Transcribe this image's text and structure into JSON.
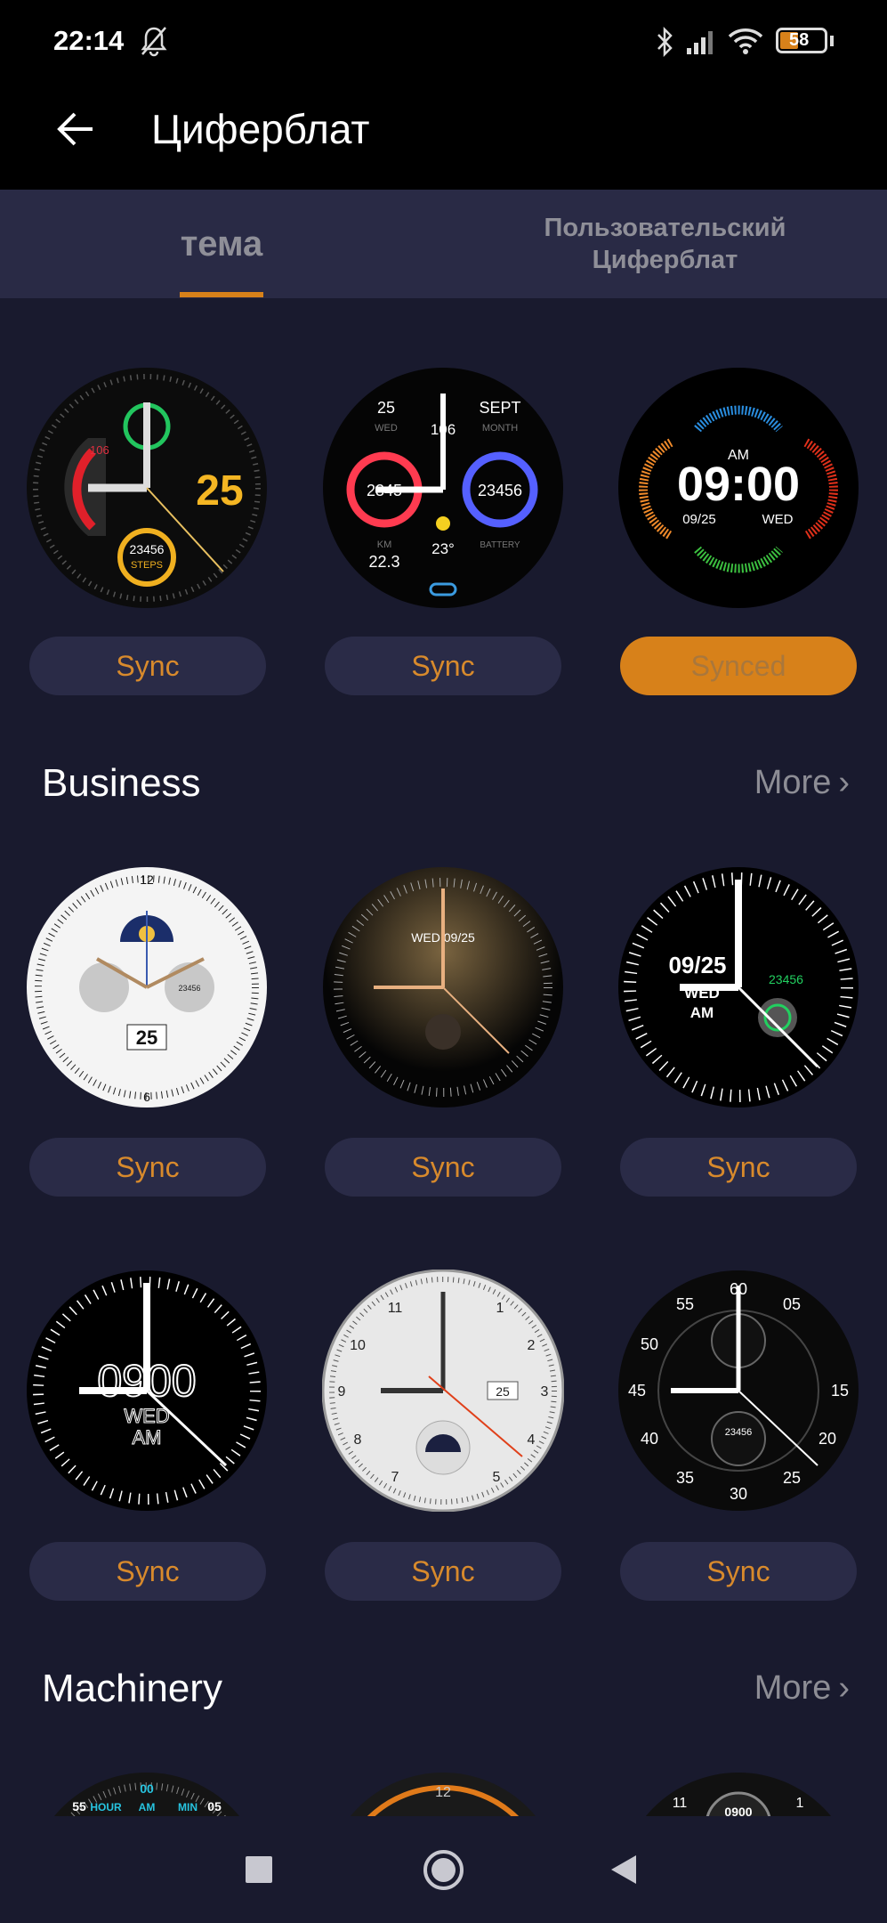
{
  "status": {
    "time": "22:14",
    "battery": "58",
    "icons": [
      "bell-off-icon",
      "bluetooth-icon",
      "signal-icon",
      "wifi-icon",
      "battery-icon"
    ]
  },
  "header": {
    "title": "Циферблат",
    "back_icon": "arrow-left-icon"
  },
  "tabs": [
    {
      "label": "тема",
      "active": true
    },
    {
      "label": "Пользовательский Циферблат",
      "active": false
    }
  ],
  "colors": {
    "background": "#191a2e",
    "tabbar": "#292a45",
    "button": "#2a2b47",
    "accent": "#d7811a",
    "button_text": "#d88a2c"
  },
  "recent": {
    "faces": [
      {
        "texts": {
          "date": "25",
          "hr": "106",
          "steps": "23456",
          "steps_label": "STEPS"
        },
        "button": "Sync"
      },
      {
        "texts": {
          "day": "25",
          "dow": "WED",
          "month": "SEPT",
          "month_label": "MONTH",
          "hr": "106",
          "cal": "2345",
          "steps": "23456",
          "temp": "23°",
          "km_label": "KM",
          "km": "22.3",
          "battery_label": "BATTERY"
        },
        "button": "Sync"
      },
      {
        "texts": {
          "ampm": "AM",
          "time": "09:00",
          "date": "09/25",
          "dow": "WED"
        },
        "button": "Synced"
      }
    ]
  },
  "business": {
    "title": "Business",
    "more": "More",
    "faces": [
      {
        "texts": {
          "date": "25",
          "num12": "12",
          "num6": "6",
          "steps": "23456"
        },
        "button": "Sync"
      },
      {
        "texts": {
          "date": "WED 09/25"
        },
        "button": "Sync"
      },
      {
        "texts": {
          "date": "09/25",
          "dow": "WED",
          "ampm": "AM",
          "steps": "23456"
        },
        "button": "Sync"
      },
      {
        "texts": {
          "time": "0900",
          "dow": "WED",
          "ampm": "AM"
        },
        "button": "Sync"
      },
      {
        "texts": {
          "date": "25",
          "n11": "11",
          "n1": "1",
          "n2": "2",
          "n10": "10",
          "n9": "9",
          "n3": "3",
          "n8": "8",
          "n4": "4",
          "n7": "7",
          "n5": "5"
        },
        "button": "Sync"
      },
      {
        "texts": {
          "n60": "60",
          "n05": "05",
          "n55": "55",
          "n50": "50",
          "n45": "45",
          "n15": "15",
          "n40": "40",
          "n20": "20",
          "n35": "35",
          "n25": "25",
          "n30": "30",
          "steps": "23456"
        },
        "button": "Sync"
      }
    ]
  },
  "machinery": {
    "title": "Machinery",
    "more": "More",
    "faces": [
      {
        "texts": {
          "top": "00",
          "l": "55",
          "r": "05",
          "hour": "HOUR",
          "am": "AM",
          "min": "MIN"
        }
      },
      {
        "texts": {
          "top": "12"
        }
      },
      {
        "texts": {
          "l": "11",
          "r": "1",
          "time": "0900"
        }
      }
    ]
  },
  "navbar": {
    "buttons": [
      "recents-square-icon",
      "home-circle-icon",
      "back-triangle-icon"
    ]
  }
}
